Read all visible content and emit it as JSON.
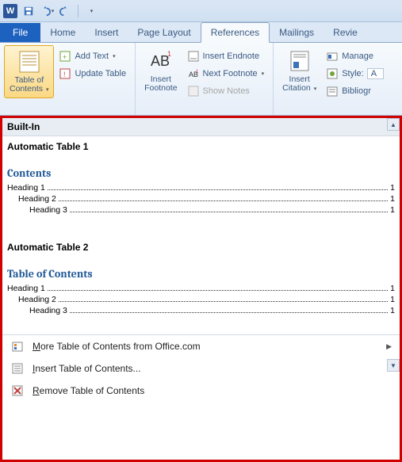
{
  "app": {
    "letter": "W"
  },
  "tabs": {
    "file": "File",
    "home": "Home",
    "insert": "Insert",
    "page_layout": "Page Layout",
    "references": "References",
    "mailings": "Mailings",
    "review": "Revie"
  },
  "ribbon": {
    "toc": {
      "label_l1": "Table of",
      "label_l2": "Contents"
    },
    "add_text": "Add Text",
    "update_table": "Update Table",
    "insert_footnote_l1": "Insert",
    "insert_footnote_l2": "Footnote",
    "insert_endnote": "Insert Endnote",
    "next_footnote": "Next Footnote",
    "show_notes": "Show Notes",
    "insert_citation_l1": "Insert",
    "insert_citation_l2": "Citation",
    "manage": "Manage",
    "style_label": "Style:",
    "style_value": "A",
    "bibliography": "Bibliogr"
  },
  "gallery": {
    "section": "Built-In",
    "item1": {
      "title": "Automatic Table 1",
      "contents_title": "Contents",
      "rows": [
        {
          "label": "Heading 1",
          "page": "1",
          "indent": 0
        },
        {
          "label": "Heading 2",
          "page": "1",
          "indent": 1
        },
        {
          "label": "Heading 3",
          "page": "1",
          "indent": 2
        }
      ]
    },
    "item2": {
      "title": "Automatic Table 2",
      "contents_title": "Table of Contents",
      "rows": [
        {
          "label": "Heading 1",
          "page": "1",
          "indent": 0
        },
        {
          "label": "Heading 2",
          "page": "1",
          "indent": 1
        },
        {
          "label": "Heading 3",
          "page": "1",
          "indent": 2
        }
      ]
    }
  },
  "menu": {
    "more": "ore Table of Contents from Office.com",
    "more_u": "M",
    "insert": "nsert Table of Contents...",
    "insert_u": "I",
    "remove": "emove Table of Contents",
    "remove_u": "R"
  }
}
